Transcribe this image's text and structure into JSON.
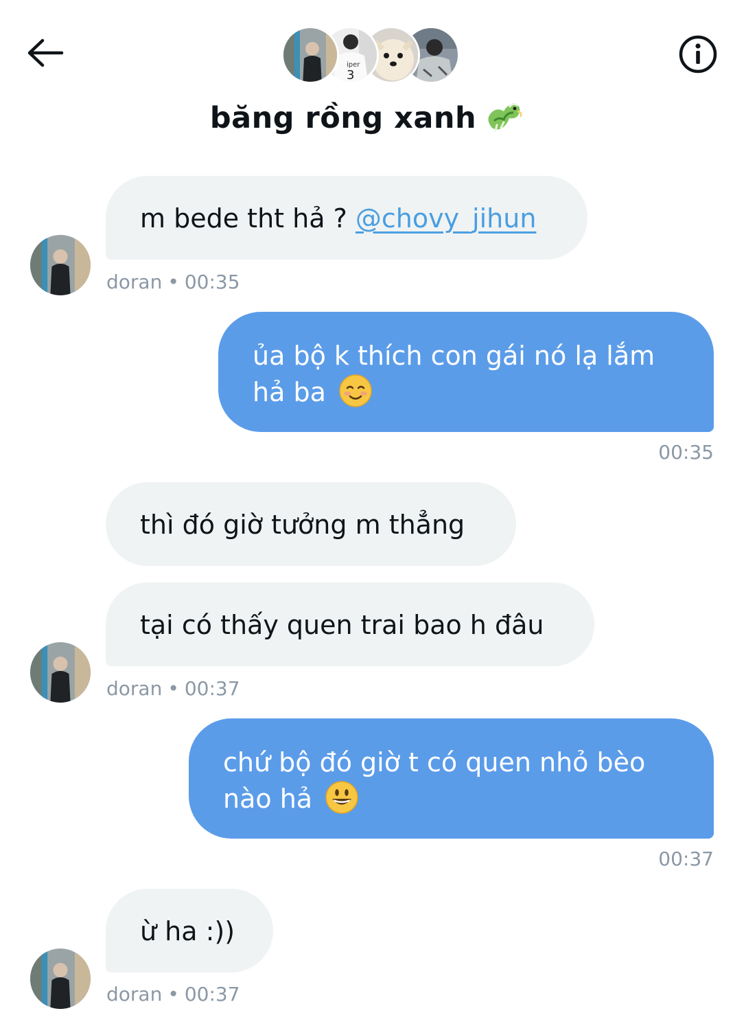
{
  "header": {
    "title": "băng rồng xanh",
    "title_emoji": "dragon-emoji"
  },
  "messages": [
    {
      "direction": "in",
      "text": "m bede tht hả ?",
      "mention": "@chovy_jihun",
      "sender": "doran",
      "time": "00:35"
    },
    {
      "direction": "out",
      "line1": "ủa bộ k thích con gái nó lạ lắm",
      "line2": "hả ba",
      "emoji": "smiling-face-icon",
      "time": "00:35"
    },
    {
      "direction": "in",
      "text": "thì đó giờ tưởng m thẳng"
    },
    {
      "direction": "in",
      "text": "tại có thấy quen trai bao h đâu",
      "sender": "doran",
      "time": "00:37"
    },
    {
      "direction": "out",
      "line1": "chứ bộ đó giờ t có quen nhỏ bèo",
      "line2": "nào hả",
      "emoji": "grinning-face-icon",
      "time": "00:37"
    },
    {
      "direction": "in",
      "text": "ừ ha :))",
      "sender": "doran",
      "time": "00:37"
    }
  ],
  "meta_separator": "•",
  "colors": {
    "outgoing_bubble": "#5b9ce9",
    "incoming_bubble": "#eff3f4",
    "mention": "#4a9ee0",
    "meta_text": "#8b98a5"
  }
}
